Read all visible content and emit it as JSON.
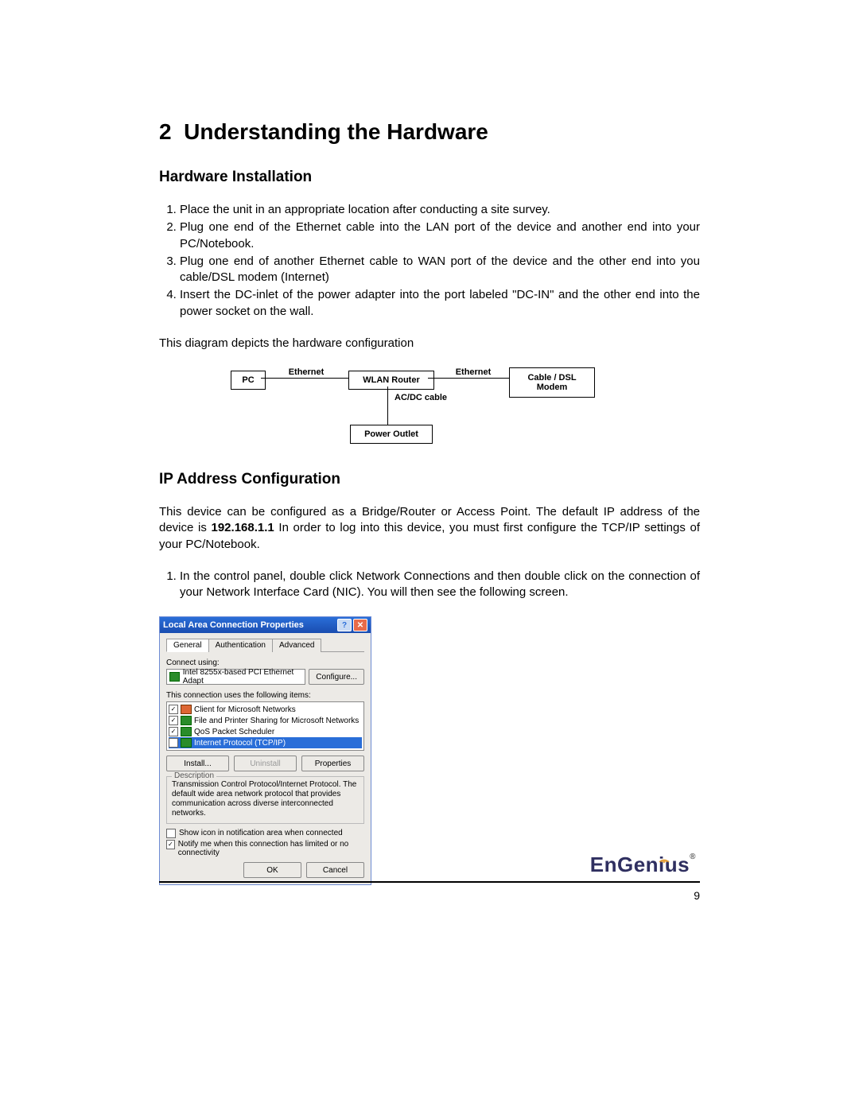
{
  "chapter": {
    "number": "2",
    "title": "Understanding the Hardware"
  },
  "section1": {
    "title": "Hardware Installation",
    "steps": [
      "Place the unit in an appropriate location after conducting a site survey.",
      "Plug one end of the Ethernet cable into the LAN port of the device and another end into your PC/Notebook.",
      "Plug one end of another Ethernet cable to WAN port of the device and the other end into you cable/DSL modem (Internet)",
      "Insert the DC-inlet of the power adapter into the port labeled \"DC-IN\" and the other end into the power socket on the wall."
    ],
    "diagram_intro": "This diagram depicts the hardware configuration"
  },
  "diagram": {
    "pc": "PC",
    "eth1": "Ethernet",
    "router": "WLAN Router",
    "eth2": "Ethernet",
    "modem": "Cable / DSL Modem",
    "acdc": "AC/DC cable",
    "outlet": "Power Outlet"
  },
  "section2": {
    "title": "IP Address Configuration",
    "intro_pre": "This device can be configured as a Bridge/Router or Access Point.  The default IP address of the device is ",
    "ip": "192.168.1.1",
    "intro_post": " In order to log into this device, you must first configure the TCP/IP settings of your PC/Notebook.",
    "step1": "In the control panel, double click Network Connections and then double click on the connection of your Network Interface Card (NIC). You will then see the following screen."
  },
  "dialog": {
    "title": "Local Area Connection Properties",
    "tabs": {
      "general": "General",
      "auth": "Authentication",
      "adv": "Advanced"
    },
    "connect_using": "Connect using:",
    "adapter": "Intel 8255x-based PCI Ethernet Adapt",
    "configure": "Configure...",
    "uses_items": "This connection uses the following items:",
    "items": [
      "Client for Microsoft Networks",
      "File and Printer Sharing for Microsoft Networks",
      "QoS Packet Scheduler",
      "Internet Protocol (TCP/IP)"
    ],
    "install": "Install...",
    "uninstall": "Uninstall",
    "properties": "Properties",
    "desc_legend": "Description",
    "desc_text": "Transmission Control Protocol/Internet Protocol. The default wide area network protocol that provides communication across diverse interconnected networks.",
    "show_icon": "Show icon in notification area when connected",
    "notify": "Notify me when this connection has limited or no connectivity",
    "ok": "OK",
    "cancel": "Cancel"
  },
  "footer": {
    "brand_a": "En",
    "brand_b": "Genius",
    "page": "9"
  }
}
